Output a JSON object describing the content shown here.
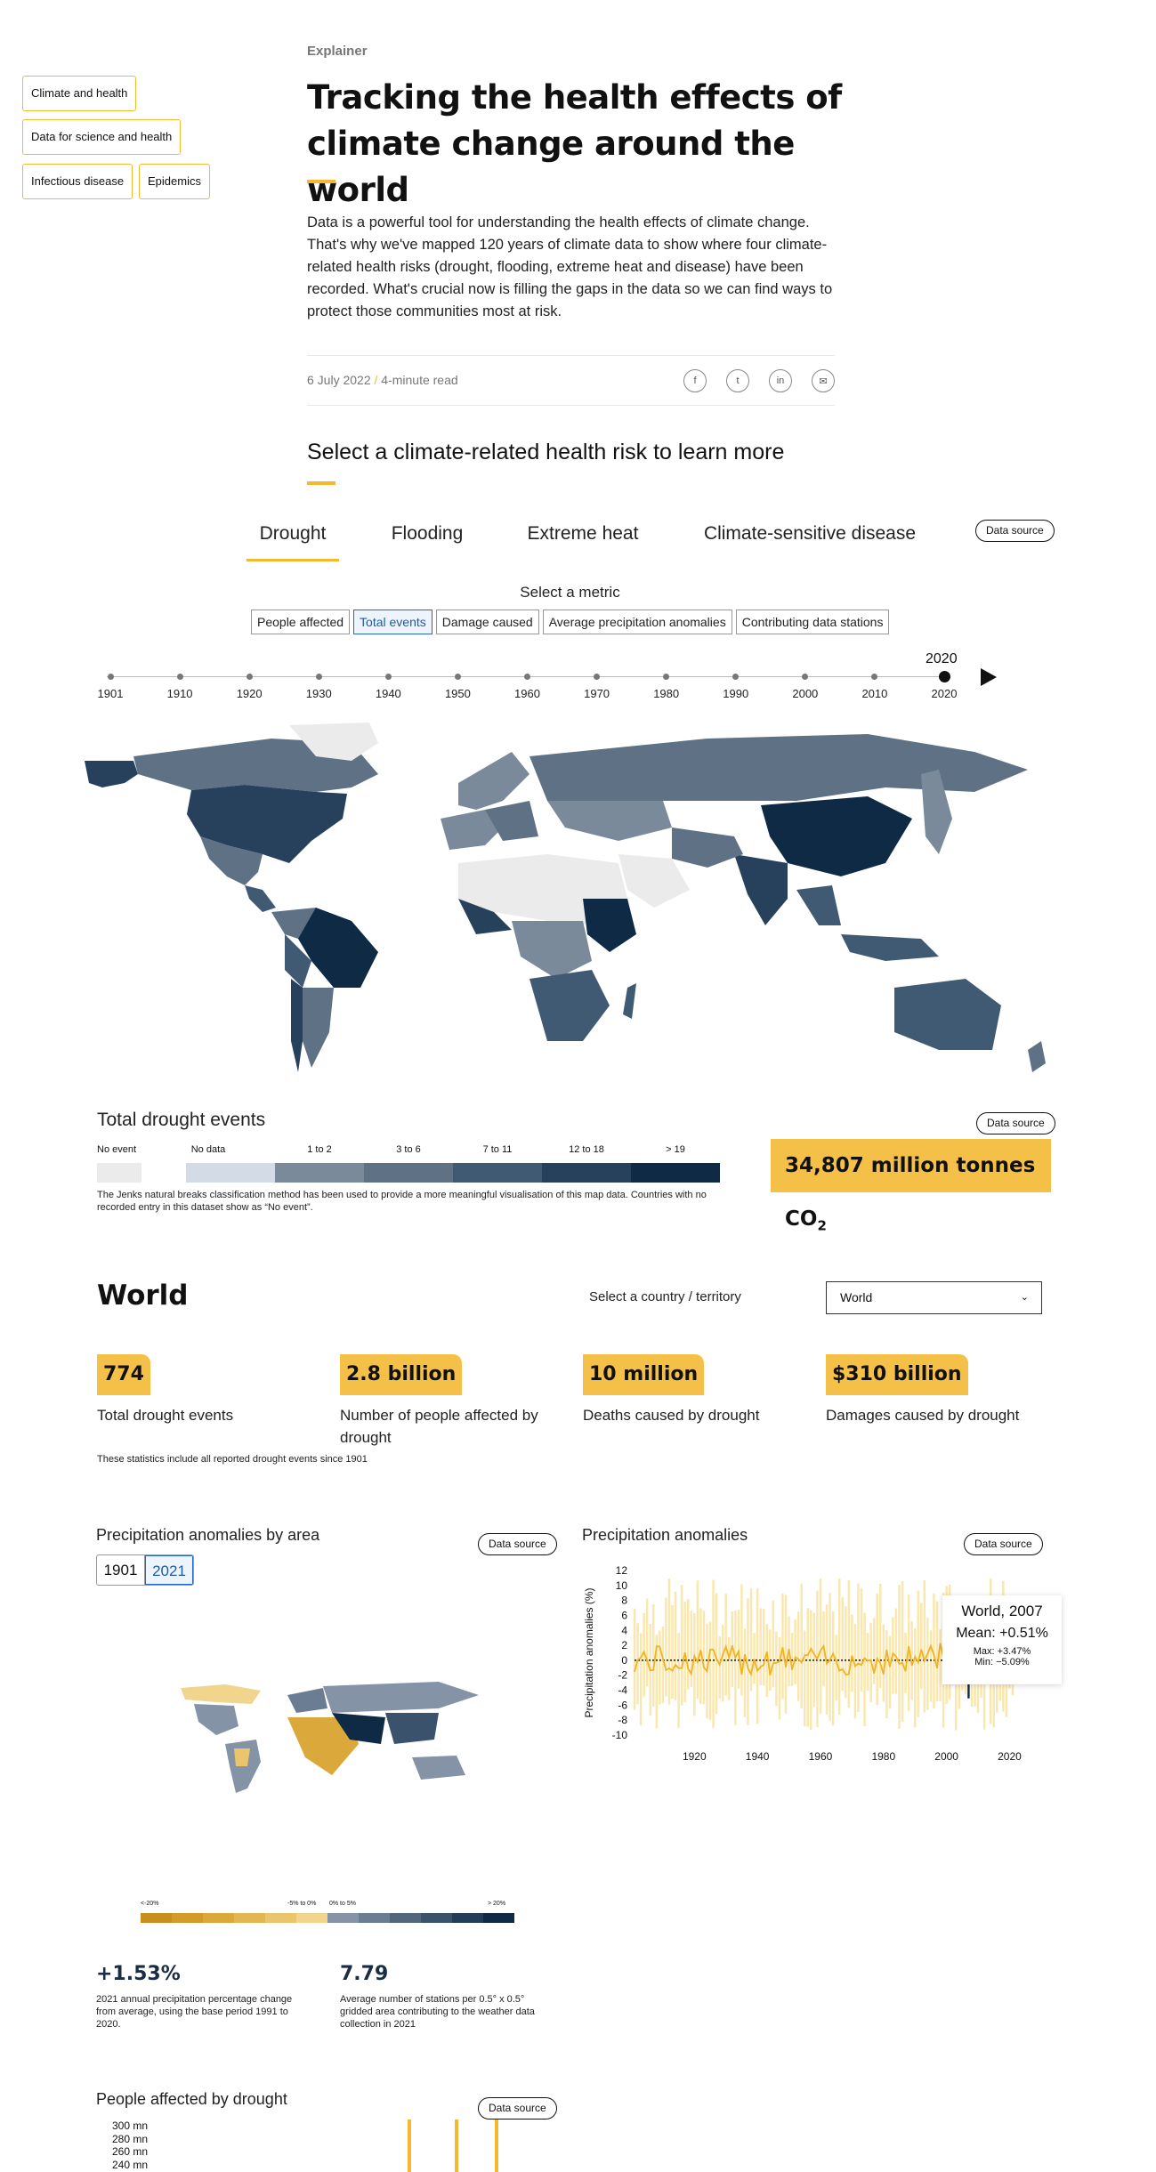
{
  "topics": [
    "Climate and health",
    "Data for science and health",
    "Infectious disease",
    "Epidemics"
  ],
  "article": {
    "kicker": "Explainer",
    "title_line1": "Tracking the health effects of",
    "title_line2": "climate change around the world",
    "intro": "Data is a powerful tool for understanding the health effects of climate change. That's why we've mapped 120 years of climate data to show where four climate-related health risks (drought, flooding, extreme heat and disease) have been recorded. What's crucial now is filling the gaps in the data so we can find ways to protect those communities most at risk.",
    "date": "6 July 2022",
    "separator": "/",
    "read_time": "4-minute read",
    "share_icons": [
      "facebook-icon",
      "twitter-icon",
      "linkedin-icon",
      "email-icon"
    ],
    "share_glyphs": [
      "f",
      "t",
      "in",
      "✉"
    ]
  },
  "select_heading": "Select a climate-related health risk to learn more",
  "tabs": [
    "Drought",
    "Flooding",
    "Extreme heat",
    "Climate-sensitive disease"
  ],
  "active_tab": "Drought",
  "data_source_label": "Data source",
  "metric_heading": "Select a metric",
  "metrics": [
    "People affected",
    "Total events",
    "Damage caused",
    "Average precipitation anomalies",
    "Contributing data stations"
  ],
  "active_metric": "Total events",
  "timeline": {
    "current_year": "2020",
    "years": [
      "1901",
      "1910",
      "1920",
      "1930",
      "1940",
      "1950",
      "1960",
      "1970",
      "1980",
      "1990",
      "2000",
      "2010",
      "2020"
    ]
  },
  "map_legend": {
    "title": "Total drought events",
    "labels": [
      "No event",
      "No data",
      "1 to 2",
      "3 to 6",
      "7 to 11",
      "12 to 18",
      "> 19"
    ],
    "colors": [
      "#ebebeb",
      "#d3dce6",
      "#7a8a9b",
      "#5f7184",
      "#405a74",
      "#27415c",
      "#0e2a45"
    ],
    "note": "The Jenks natural breaks classification method has been used to provide a more meaningful visualisation of this map data. Countries with no recorded entry in this dataset show as “No event”."
  },
  "co2": {
    "prefix": "34,807 million tonnes CO",
    "sub": "2"
  },
  "world": {
    "title": "World",
    "select_label": "Select a country / territory",
    "select_value": "World",
    "stats": [
      {
        "value": "774",
        "label": "Total drought events"
      },
      {
        "value": "2.8 billion",
        "label": "Number of people affected by drought"
      },
      {
        "value": "10 million",
        "label": "Deaths caused by drought"
      },
      {
        "value": "$310 billion",
        "label": "Damages caused by drought"
      }
    ],
    "note": "These statistics include all reported drought events since 1901"
  },
  "precip_area": {
    "title": "Precipitation anomalies by area",
    "years": [
      "1901",
      "2021"
    ],
    "active_year": "2021",
    "legend_labels": [
      "<-20%",
      "-5% to 0%",
      "0% to 5%",
      "> 20%"
    ],
    "legend_colors": [
      "#c98f1c",
      "#d39b2a",
      "#dba93b",
      "#e3b651",
      "#ebc56c",
      "#f2d58d",
      "#8494a6",
      "#6a7d92",
      "#52677e",
      "#3a526b",
      "#223d58",
      "#0f2a45"
    ],
    "stats": [
      {
        "value": "+1.53%",
        "label": "2021 annual precipitation percentage change from average, using the base period 1991 to 2020."
      },
      {
        "value": "7.79",
        "label": "Average number of stations per 0.5° x 0.5° gridded area contributing to the weather data collection in 2021"
      }
    ]
  },
  "precip_chart": {
    "title": "Precipitation anomalies",
    "tooltip": {
      "title": "World, 2007",
      "mean": "Mean: +0.51%",
      "max": "Max: +3.47%",
      "min": "Min: −5.09%"
    },
    "chart_data": {
      "type": "bar",
      "ylabel": "Precipitation anomalies (%)",
      "ylim": [
        -10,
        12
      ],
      "yticks": [
        12,
        10,
        8,
        6,
        4,
        2,
        0,
        -2,
        -4,
        -6,
        -8,
        -10
      ],
      "xticks": [
        1920,
        1940,
        1960,
        1980,
        2000,
        2020
      ],
      "xlim": [
        1901,
        2021
      ],
      "highlight_year": 2007,
      "highlight": {
        "mean": 0.51,
        "max": 3.47,
        "min": -5.09
      },
      "colors": {
        "range": "#f5c94a",
        "mean": "#f0b323",
        "highlight": "#0f2a45"
      }
    }
  },
  "people_chart": {
    "title": "People affected by drought",
    "yticks": [
      "300 mn",
      "280 mn",
      "260 mn",
      "240 mn"
    ]
  }
}
